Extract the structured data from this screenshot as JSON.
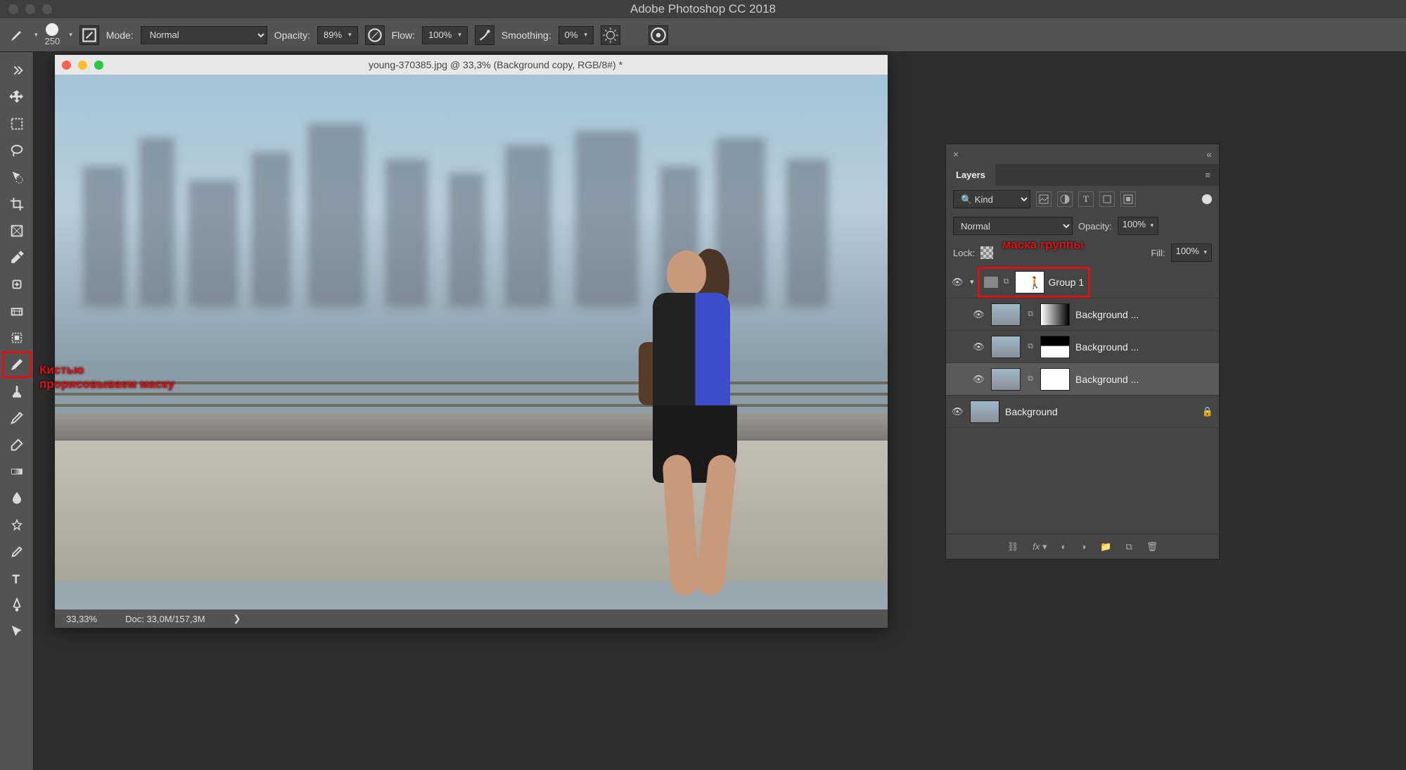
{
  "app": {
    "title": "Adobe Photoshop CC 2018"
  },
  "options": {
    "brush_size": "250",
    "mode_label": "Mode:",
    "mode_value": "Normal",
    "opacity_label": "Opacity:",
    "opacity_value": "89%",
    "flow_label": "Flow:",
    "flow_value": "100%",
    "smoothing_label": "Smoothing:",
    "smoothing_value": "0%"
  },
  "tools": [
    {
      "name": "move-tool"
    },
    {
      "name": "marquee-tool"
    },
    {
      "name": "lasso-tool"
    },
    {
      "name": "quick-select-tool"
    },
    {
      "name": "crop-tool"
    },
    {
      "name": "frame-tool"
    },
    {
      "name": "eyedropper-tool"
    },
    {
      "name": "healing-brush-tool"
    },
    {
      "name": "patch-tool"
    },
    {
      "name": "artboard-tool"
    },
    {
      "name": "brush-tool"
    },
    {
      "name": "clone-stamp-tool"
    },
    {
      "name": "history-brush-tool"
    },
    {
      "name": "eraser-tool"
    },
    {
      "name": "gradient-tool"
    },
    {
      "name": "blur-tool"
    },
    {
      "name": "dodge-tool"
    },
    {
      "name": "pen-like-tool"
    },
    {
      "name": "type-tool"
    },
    {
      "name": "pen-tool"
    },
    {
      "name": "path-select-tool"
    }
  ],
  "annot": {
    "brush": [
      "Кистью",
      "прорисовываем маску"
    ],
    "group_mask": "маска группы"
  },
  "document": {
    "title": "young-370385.jpg @ 33,3% (Background copy, RGB/8#) *",
    "zoom": "33,33%",
    "docsize": "Doc: 33,0M/157,3M"
  },
  "layers_panel": {
    "tab": "Layers",
    "filter_label": "Kind",
    "blend_mode": "Normal",
    "opacity_label": "Opacity:",
    "opacity_value": "100%",
    "lock_label": "Lock:",
    "fill_label": "Fill:",
    "fill_value": "100%",
    "layers": [
      {
        "name": "Group 1",
        "type": "group",
        "mask": "figure"
      },
      {
        "name": "Background ...",
        "type": "layer",
        "mask": "grad"
      },
      {
        "name": "Background ...",
        "type": "layer",
        "mask": "half"
      },
      {
        "name": "Background ...",
        "type": "layer",
        "mask": "white",
        "selected": true
      },
      {
        "name": "Background",
        "type": "bg",
        "locked": true
      }
    ]
  }
}
